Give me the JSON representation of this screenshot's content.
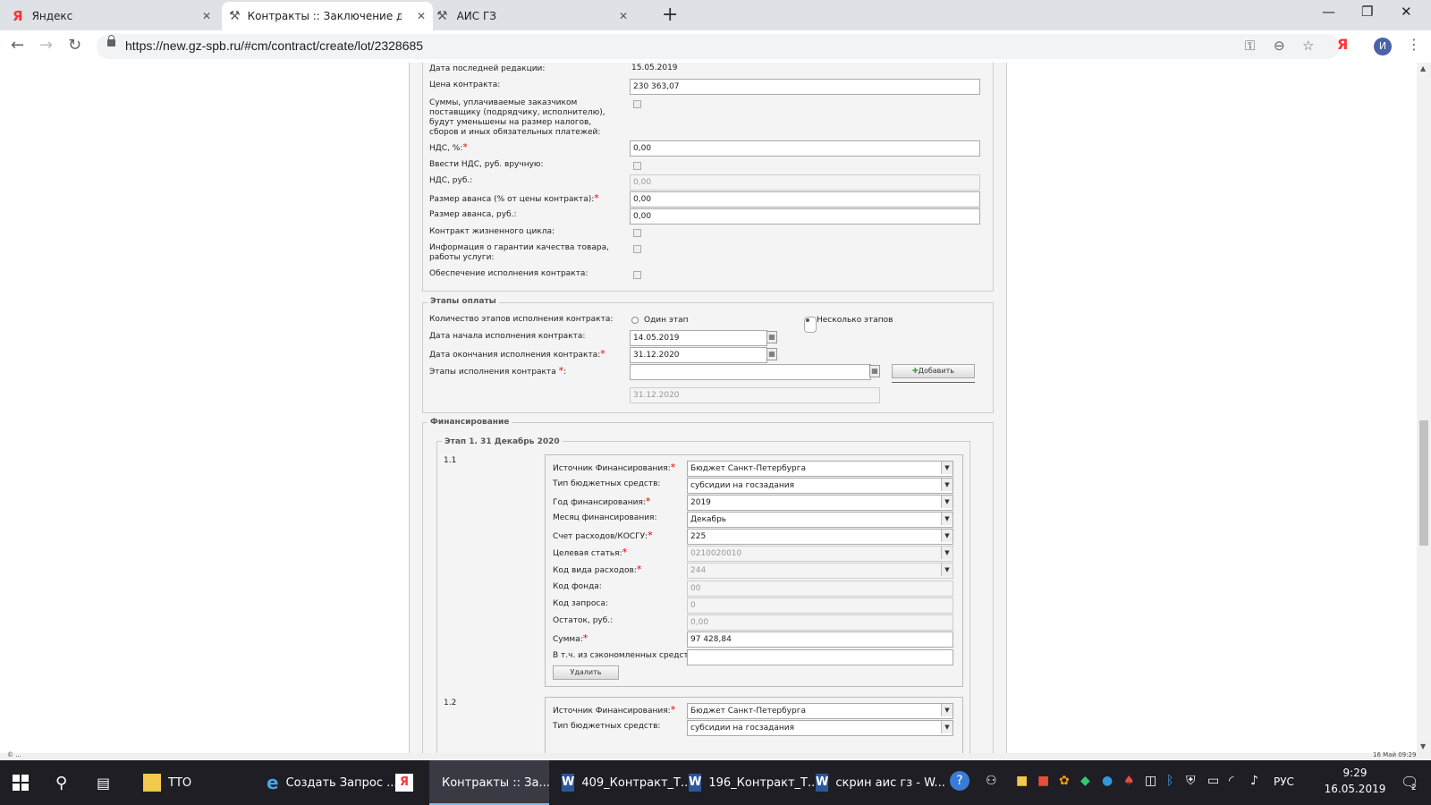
{
  "browser": {
    "tabs": [
      {
        "label": "Яндекс",
        "active": false
      },
      {
        "label": "Контракты :: Заключение догов",
        "active": true
      },
      {
        "label": "АИС ГЗ",
        "active": false
      }
    ],
    "url": "https://new.gz-spb.ru/#cm/contract/create/lot/2328685",
    "avatar_letter": "И",
    "ya_ext": "Я"
  },
  "form": {
    "last_edit_label": "Дата последней редакции:",
    "last_edit_value": "15.05.2019",
    "price_label": "Цена контракта:",
    "price_value": "230 363,07",
    "taxes_label": "Суммы, уплачиваемые заказчиком поставщику (подрядчику, исполнителю), будут уменьшены на размер налогов, сборов и иных обязательных платежей:",
    "vat_pct_label": "НДС, %:",
    "vat_pct_value": "0,00",
    "vat_manual_label": "Ввести НДС, руб. вручную:",
    "vat_rub_label": "НДС, руб.:",
    "vat_rub_value": "0,00",
    "advance_pct_label": "Размер аванса (% от цены контракта):",
    "advance_pct_value": "0,00",
    "advance_rub_label": "Размер аванса, руб.:",
    "advance_rub_value": "0,00",
    "lifecycle_label": "Контракт жизненного цикла:",
    "guarantee_label": "Информация о гарантии качества товара, работы услуги:",
    "security_label": "Обеспечение исполнения контракта:"
  },
  "payment": {
    "legend": "Этапы оплаты",
    "stages_count_label": "Количество этапов исполнения контракта:",
    "option_one": "Один этап",
    "option_many": "Несколько этапов",
    "start_label": "Дата начала исполнения контракта:",
    "start_value": "14.05.2019",
    "end_label": "Дата окончания исполнения контракта:",
    "end_value": "31.12.2020",
    "stages_label": "Этапы исполнения контракта",
    "add_button": "Добавить",
    "stage_date": "31.12.2020"
  },
  "financing": {
    "legend": "Финансирование",
    "stage_legend": "Этап 1. 31 Декабрь 2020",
    "items": [
      {
        "num": "1.1",
        "source_label": "Источник Финансирования:",
        "source_value": "Бюджет Санкт-Петербурга",
        "type_label": "Тип бюджетных средств:",
        "type_value": "субсидии на госзадания",
        "year_label": "Год финансирования:",
        "year_value": "2019",
        "month_label": "Месяц финансирования:",
        "month_value": "Декабрь",
        "account_label": "Счет расходов/КОСГУ:",
        "account_value": "225",
        "target_label": "Целевая статья:",
        "target_value": "0210020010",
        "kvr_label": "Код вида расходов:",
        "kvr_value": "244",
        "fund_label": "Код фонда:",
        "fund_value": "00",
        "request_label": "Код запроса:",
        "request_value": "0",
        "remainder_label": "Остаток, руб.:",
        "remainder_value": "0,00",
        "sum_label": "Сумма:",
        "sum_value": "97 428,84",
        "savings_label": "В т.ч. из сэкономленных средств:",
        "savings_value": "",
        "delete_button": "Удалить"
      },
      {
        "num": "1.2",
        "source_label": "Источник Финансирования:",
        "source_value": "Бюджет Санкт-Петербурга",
        "type_label": "Тип бюджетных средств:",
        "type_value": "субсидии на госзадания"
      }
    ]
  },
  "status": {
    "left": "© ...",
    "right": "16 Май 09:29"
  },
  "taskbar": {
    "items": [
      {
        "label": "ТТО"
      },
      {
        "label": "Создать Запрос ..."
      },
      {
        "label": "Контракты :: За..."
      },
      {
        "label": "409_Контракт_Т..."
      },
      {
        "label": "196_Контракт_Т..."
      },
      {
        "label": "скрин аис гз - W..."
      }
    ],
    "lang": "РУС",
    "time": "9:29",
    "date": "16.05.2019",
    "notif_count": "2"
  }
}
